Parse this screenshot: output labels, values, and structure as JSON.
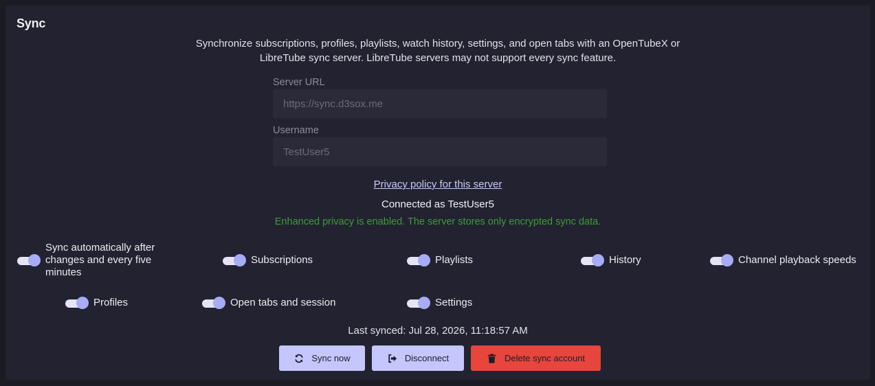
{
  "section": {
    "title": "Sync"
  },
  "description": {
    "line1": "Synchronize subscriptions, profiles, playlists, watch history, settings, and open tabs with an OpenTubeX or",
    "line2": "LibreTube sync server. LibreTube servers may not support every sync feature."
  },
  "server_url": {
    "label": "Server URL",
    "placeholder": "https://sync.d3sox.me"
  },
  "username": {
    "label": "Username",
    "placeholder": "TestUser5"
  },
  "privacy_link": "Privacy policy for this server",
  "connected_text": "Connected as TestUser5",
  "privacy_note": "Enhanced privacy is enabled. The server stores only encrypted sync data.",
  "toggles": [
    {
      "label_line1": "Sync automatically after",
      "label_line2": "changes and every five",
      "label_line3": "minutes",
      "checked": true
    },
    {
      "label": "Subscriptions",
      "checked": true
    },
    {
      "label": "Playlists",
      "checked": true
    },
    {
      "label": "History",
      "checked": true
    },
    {
      "label": "Channel playback speeds",
      "checked": true
    },
    {
      "label": "Profiles",
      "checked": true
    },
    {
      "label": "Open tabs and session",
      "checked": true
    },
    {
      "label": "Settings",
      "checked": true
    }
  ],
  "last_synced": "Last synced: Jul 28, 2026, 11:18:57 AM",
  "buttons": {
    "sync_now": {
      "label": "Sync now",
      "icon": "sync-icon"
    },
    "disconnect": {
      "label": "Disconnect",
      "icon": "sign-out-icon"
    },
    "delete": {
      "label": "Delete sync account",
      "icon": "trash-icon"
    }
  },
  "colors": {
    "accent": "#c5c6fb",
    "danger": "#e8453c",
    "success": "#3f9b3a",
    "panel": "#222230",
    "background": "#1b1b24"
  }
}
